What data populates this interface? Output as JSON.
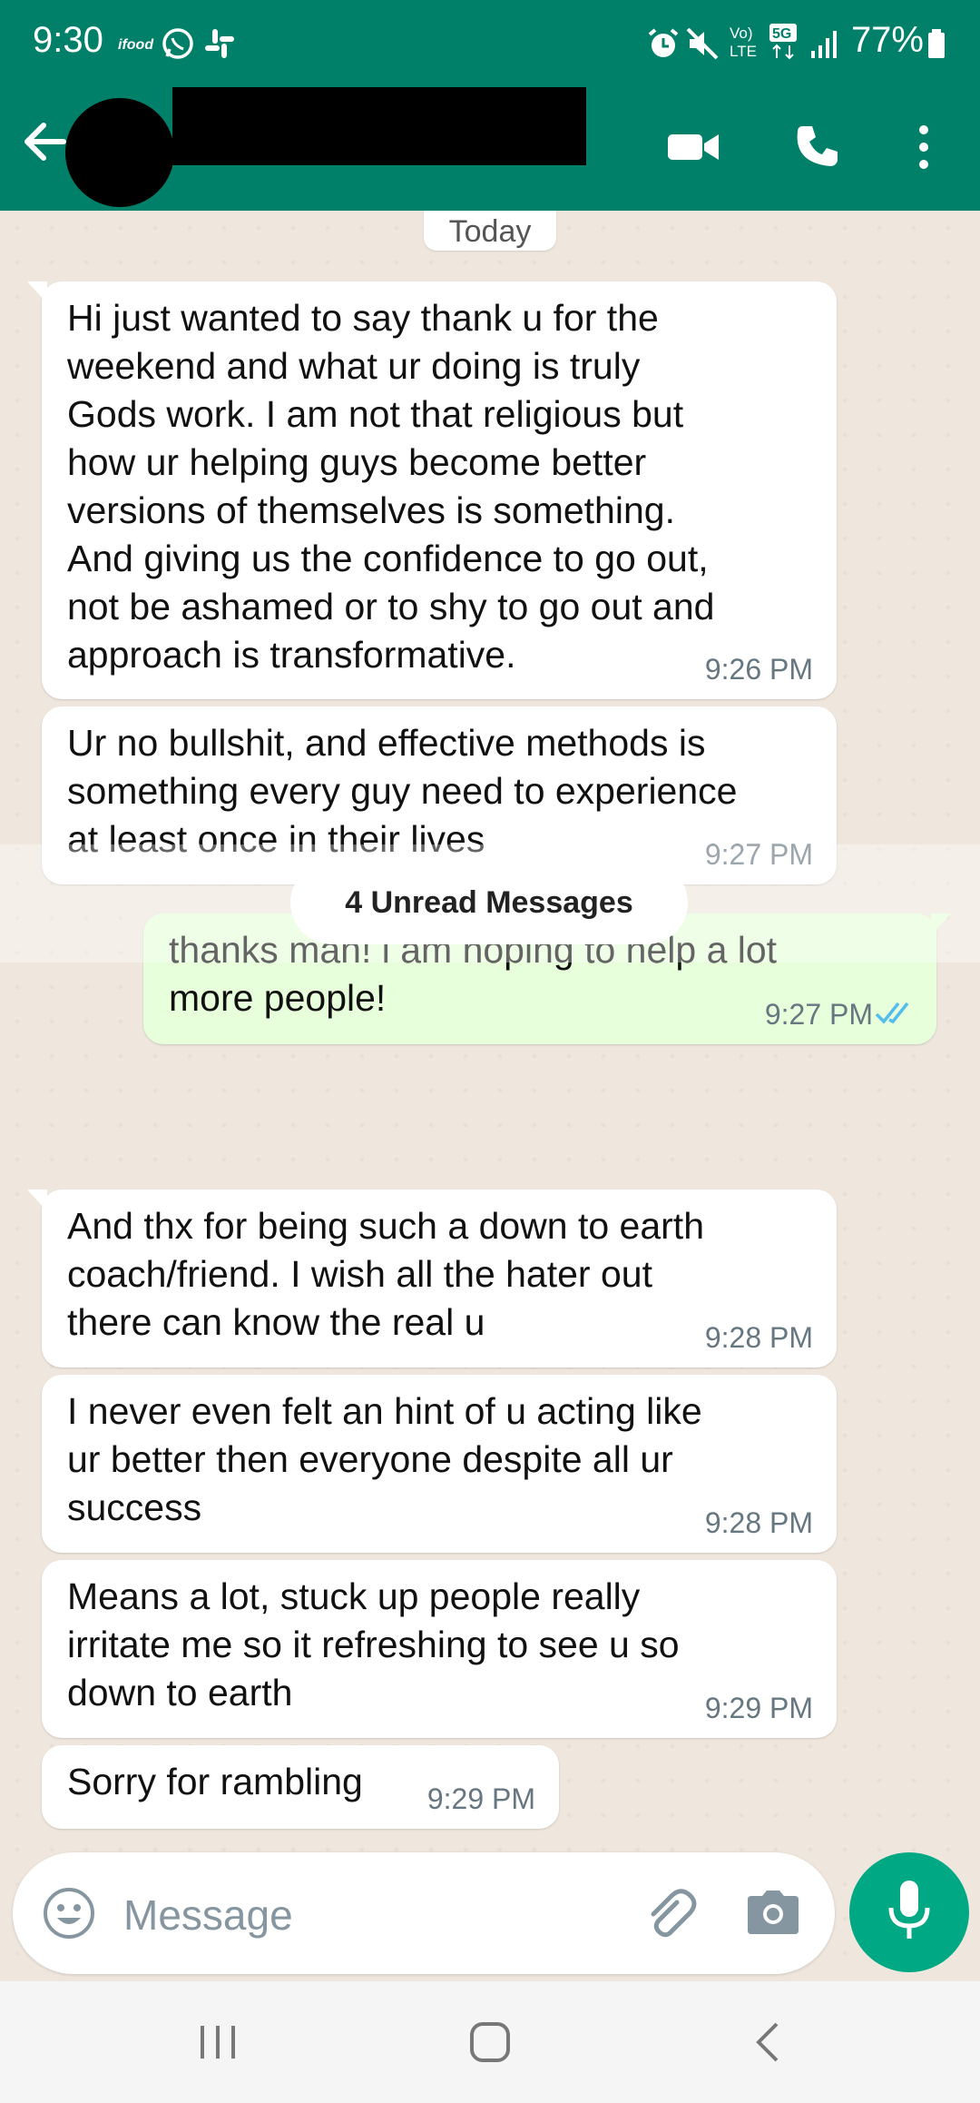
{
  "status_bar": {
    "time": "9:30",
    "network": "5G",
    "volte": "Vo) LTE",
    "battery": "77%"
  },
  "header": {
    "contact_name": "",
    "colors": {
      "header_bg": "#008069",
      "accent": "#00a884"
    }
  },
  "chat": {
    "date_chip": "Today",
    "messages": [
      {
        "dir": "in",
        "text": "Hi just wanted to say thank u for the\nweekend and what ur doing is truly\nGods work. I am not that religious but\nhow ur helping guys  become better\nversions of themselves is something.\nAnd giving us the confidence to go out,\nnot be ashamed or to shy to go out and\napproach is transformative.",
        "time": "9:26 PM"
      },
      {
        "dir": "in",
        "text": "Ur no bullshit, and effective methods is\nsomething every guy need to experience\nat least once in their lives",
        "time": "9:27 PM"
      },
      {
        "dir": "out",
        "text": "thanks man! i am hoping to help a lot\nmore people!",
        "time": "9:27 PM",
        "status_icon": "double-check-read-icon"
      },
      {
        "dir": "in",
        "text": "And thx for being such a down to earth\ncoach/friend. I wish all the hater out\nthere can know the real u",
        "time": "9:28 PM"
      },
      {
        "dir": "in",
        "text": "I never even felt an hint of u acting like\nur better then everyone despite all ur\nsuccess",
        "time": "9:28 PM"
      },
      {
        "dir": "in",
        "text": "Means a lot, stuck up people really\nirritate me so it refreshing to see u so\ndown to earth",
        "time": "9:29 PM"
      },
      {
        "dir": "in",
        "text": "Sorry for rambling",
        "time": "9:29 PM"
      }
    ],
    "unread_label": "4 Unread Messages"
  },
  "composer": {
    "placeholder": "Message"
  }
}
